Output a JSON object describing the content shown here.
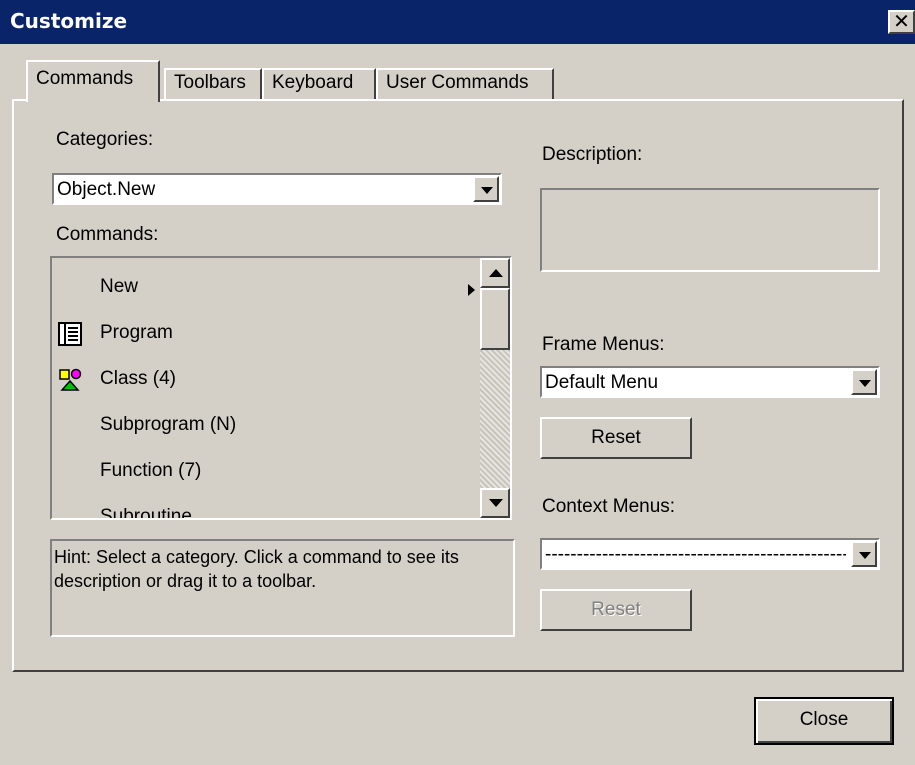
{
  "window": {
    "title": "Customize",
    "close_glyph": "✕"
  },
  "tabs": [
    {
      "label": "Commands",
      "active": true
    },
    {
      "label": "Toolbars",
      "active": false
    },
    {
      "label": "Keyboard",
      "active": false
    },
    {
      "label": "User Commands",
      "active": false
    }
  ],
  "categories": {
    "label": "Categories:",
    "value": "Object.New"
  },
  "commands": {
    "label": "Commands:",
    "items": [
      {
        "label": "New",
        "icon": "",
        "submenu": true
      },
      {
        "label": "Program",
        "icon": "program-icon"
      },
      {
        "label": "Class (4)",
        "icon": "class-icon"
      },
      {
        "label": "Subprogram (N)",
        "icon": ""
      },
      {
        "label": "Function (7)",
        "icon": ""
      },
      {
        "label": "Subroutine",
        "icon": ""
      }
    ]
  },
  "hint": "Hint: Select a category. Click a command to see its description or drag it to a toolbar.",
  "description": {
    "label": "Description:"
  },
  "frame_menus": {
    "label": "Frame Menus:",
    "value": "Default Menu",
    "reset_label": "Reset"
  },
  "context_menus": {
    "label": "Context Menus:",
    "value": "------------------------------------------------",
    "reset_label": "Reset"
  },
  "footer": {
    "close_label": "Close"
  },
  "colors": {
    "titlebar": "#0a246a",
    "face": "#d4d0c8",
    "class_icon_yellow": "#ffff00",
    "class_icon_magenta": "#ff00ff",
    "class_icon_green": "#00a000"
  }
}
